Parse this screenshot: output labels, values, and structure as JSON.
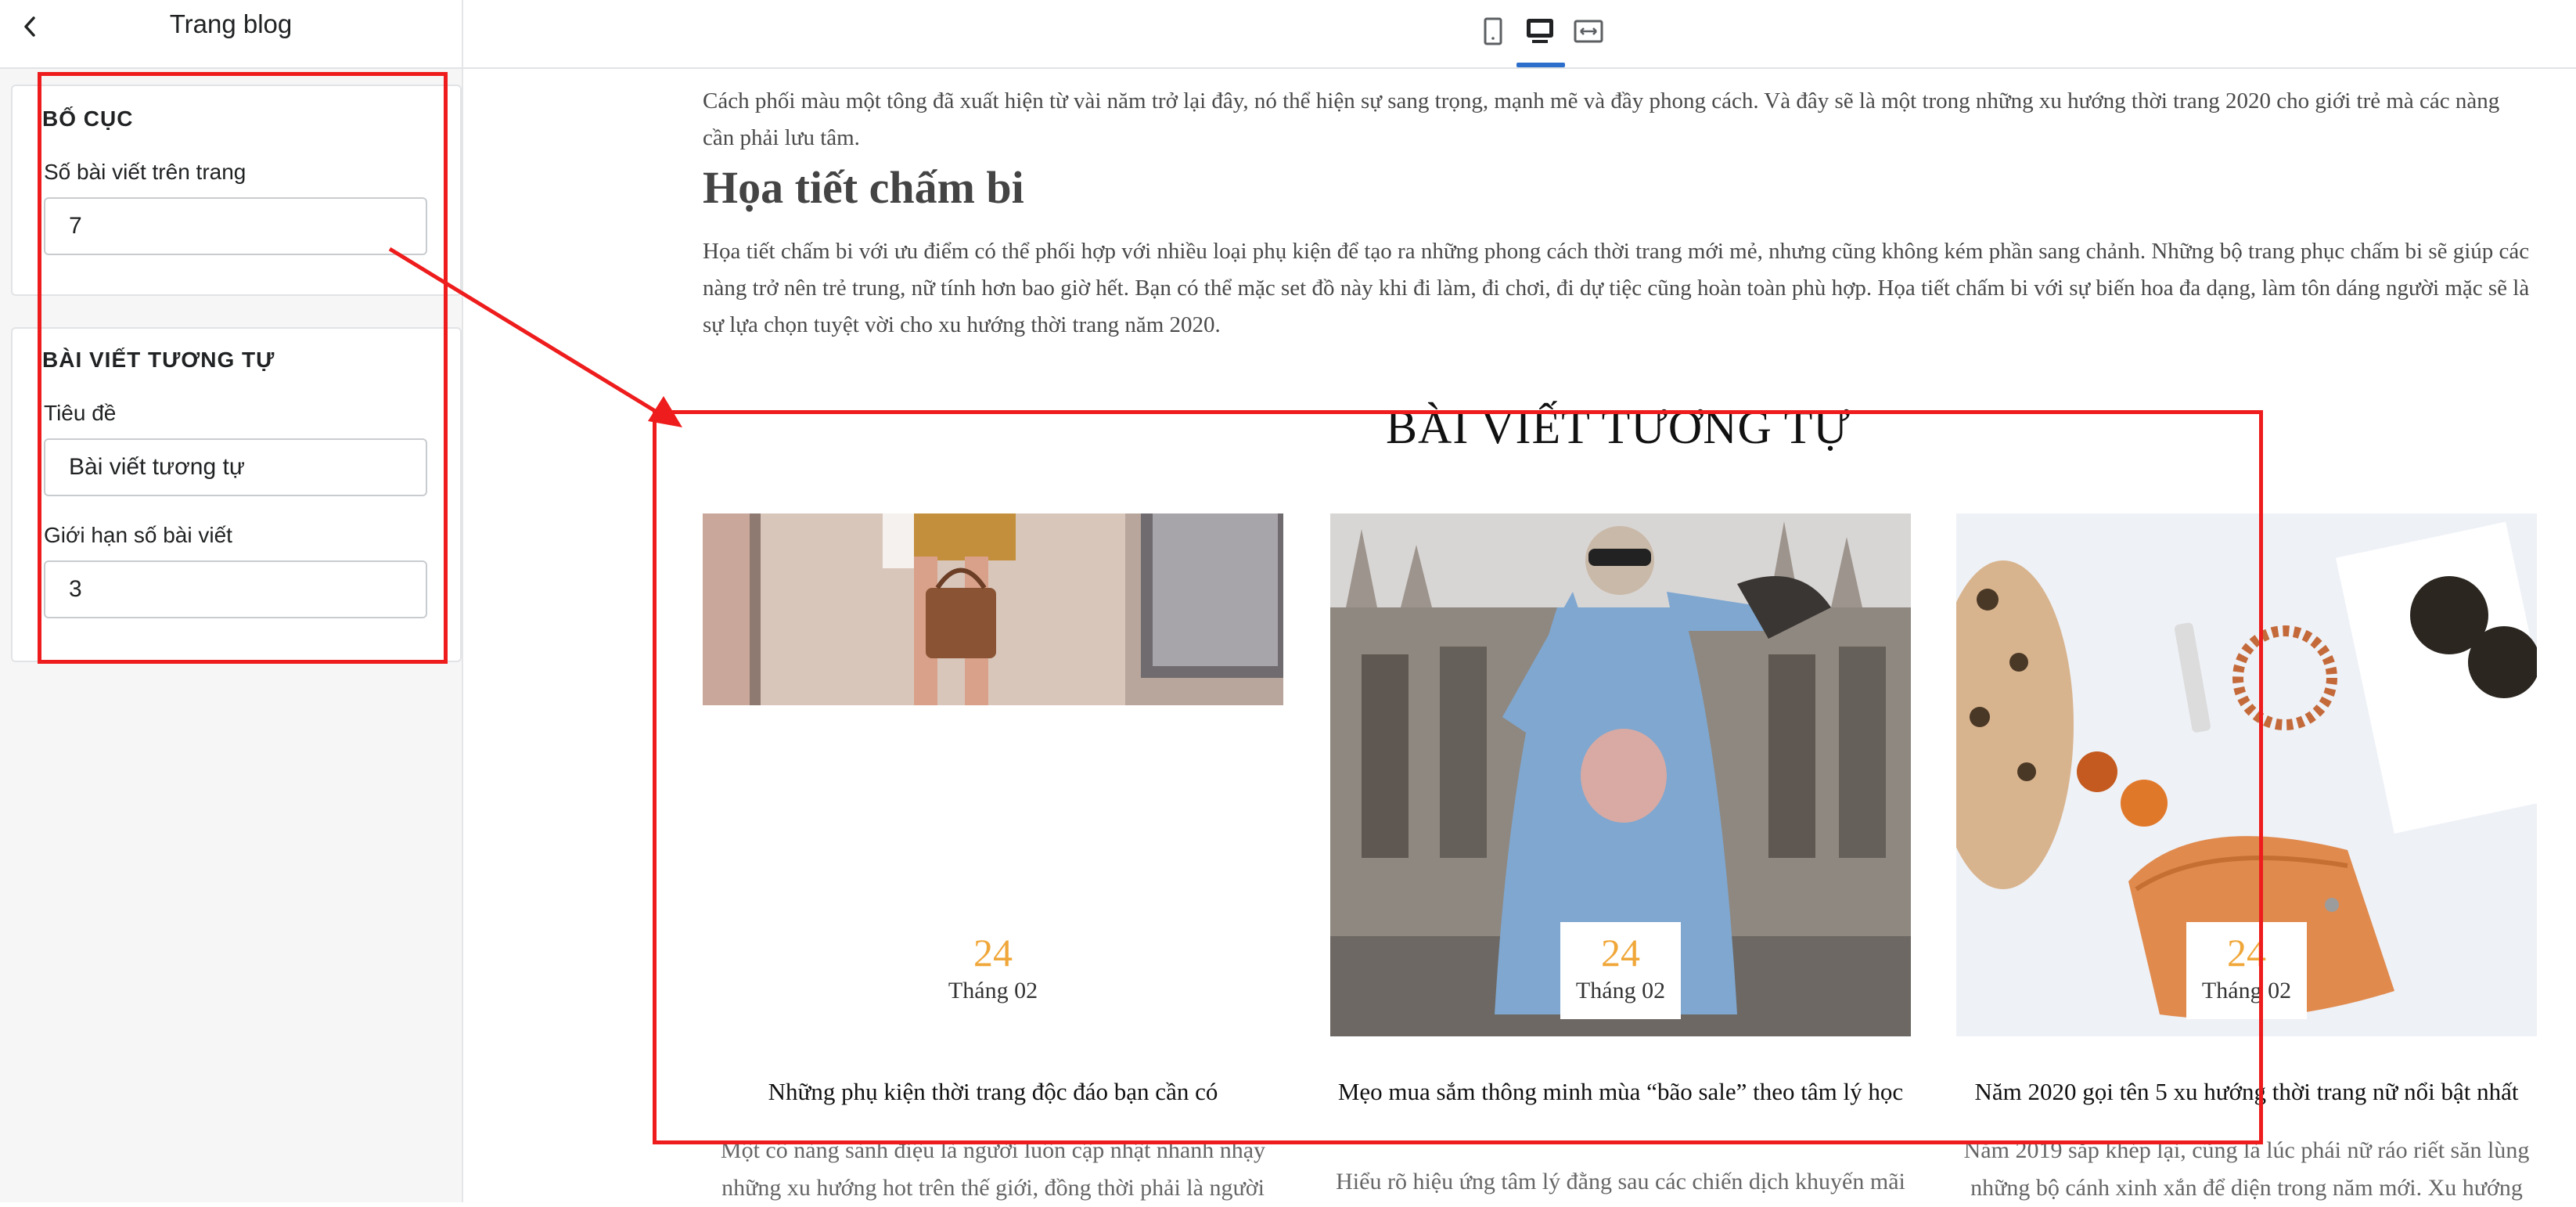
{
  "sidebar": {
    "title": "Trang blog",
    "layout": {
      "heading": "BỐ CỤC",
      "posts_per_page_label": "Số bài viết trên trang",
      "posts_per_page_value": "7"
    },
    "related": {
      "heading": "BÀI VIẾT TƯƠNG TỰ",
      "title_label": "Tiêu đề",
      "title_value": "Bài viết tương tự",
      "limit_label": "Giới hạn số bài viết",
      "limit_value": "3"
    }
  },
  "toolbar": {
    "active_view": "desktop",
    "icons": [
      "mobile-icon",
      "desktop-icon",
      "fullwidth-icon"
    ]
  },
  "preview": {
    "intro_paragraph": "Cách phối màu một tông đã xuất hiện từ vài năm trở lại đây, nó thể hiện sự sang trọng, mạnh mẽ và đầy phong cách. Và đây sẽ là một trong những xu hướng thời trang 2020 cho giới trẻ mà các nàng cần phải lưu tâm.",
    "section_heading": "Họa tiết chấm bi",
    "section_paragraph": "Họa tiết chấm bi với ưu điểm có thể phối hợp với nhiều loại phụ kiện để tạo ra những phong cách thời trang mới mẻ, nhưng cũng không kém phần sang chảnh. Những bộ trang phục chấm bi sẽ giúp các nàng trở nên trẻ trung, nữ tính hơn bao giờ hết. Bạn có thể mặc set đồ này khi đi làm, đi chơi, đi dự tiệc cũng hoàn toàn phù hợp. Họa tiết chấm bi với sự biến hoa đa dạng, làm tôn dáng người mặc sẽ là sự lựa chọn tuyệt vời cho xu hướng thời trang năm 2020.",
    "related_title": "BÀI VIẾT TƯƠNG TỰ",
    "posts": [
      {
        "day": "24",
        "month": "Tháng 02",
        "title": "Những phụ kiện thời trang độc đáo bạn cần có",
        "excerpt": "Một cô nàng sành điệu là người luôn cập nhật nhanh nhạy những xu hướng hot trên thế giới, đồng thời phải là người"
      },
      {
        "day": "24",
        "month": "Tháng 02",
        "title": "Mẹo mua sắm thông minh mùa “bão sale” theo tâm lý học",
        "excerpt": "Hiểu rõ hiệu ứng tâm lý đằng sau các chiến dịch khuyến mãi"
      },
      {
        "day": "24",
        "month": "Tháng 02",
        "title": "Năm 2020 gọi tên 5 xu hướng thời trang nữ nổi bật nhất",
        "excerpt": "Năm 2019 sắp khép lại, cũng là lúc phái nữ ráo riết săn lùng những bộ cánh xinh xắn để diện trong năm mới. Xu hướng"
      }
    ]
  },
  "colors": {
    "accent": "#2c6ecb",
    "date_day": "#f0a73a",
    "annotation": "#ee1c1c"
  }
}
